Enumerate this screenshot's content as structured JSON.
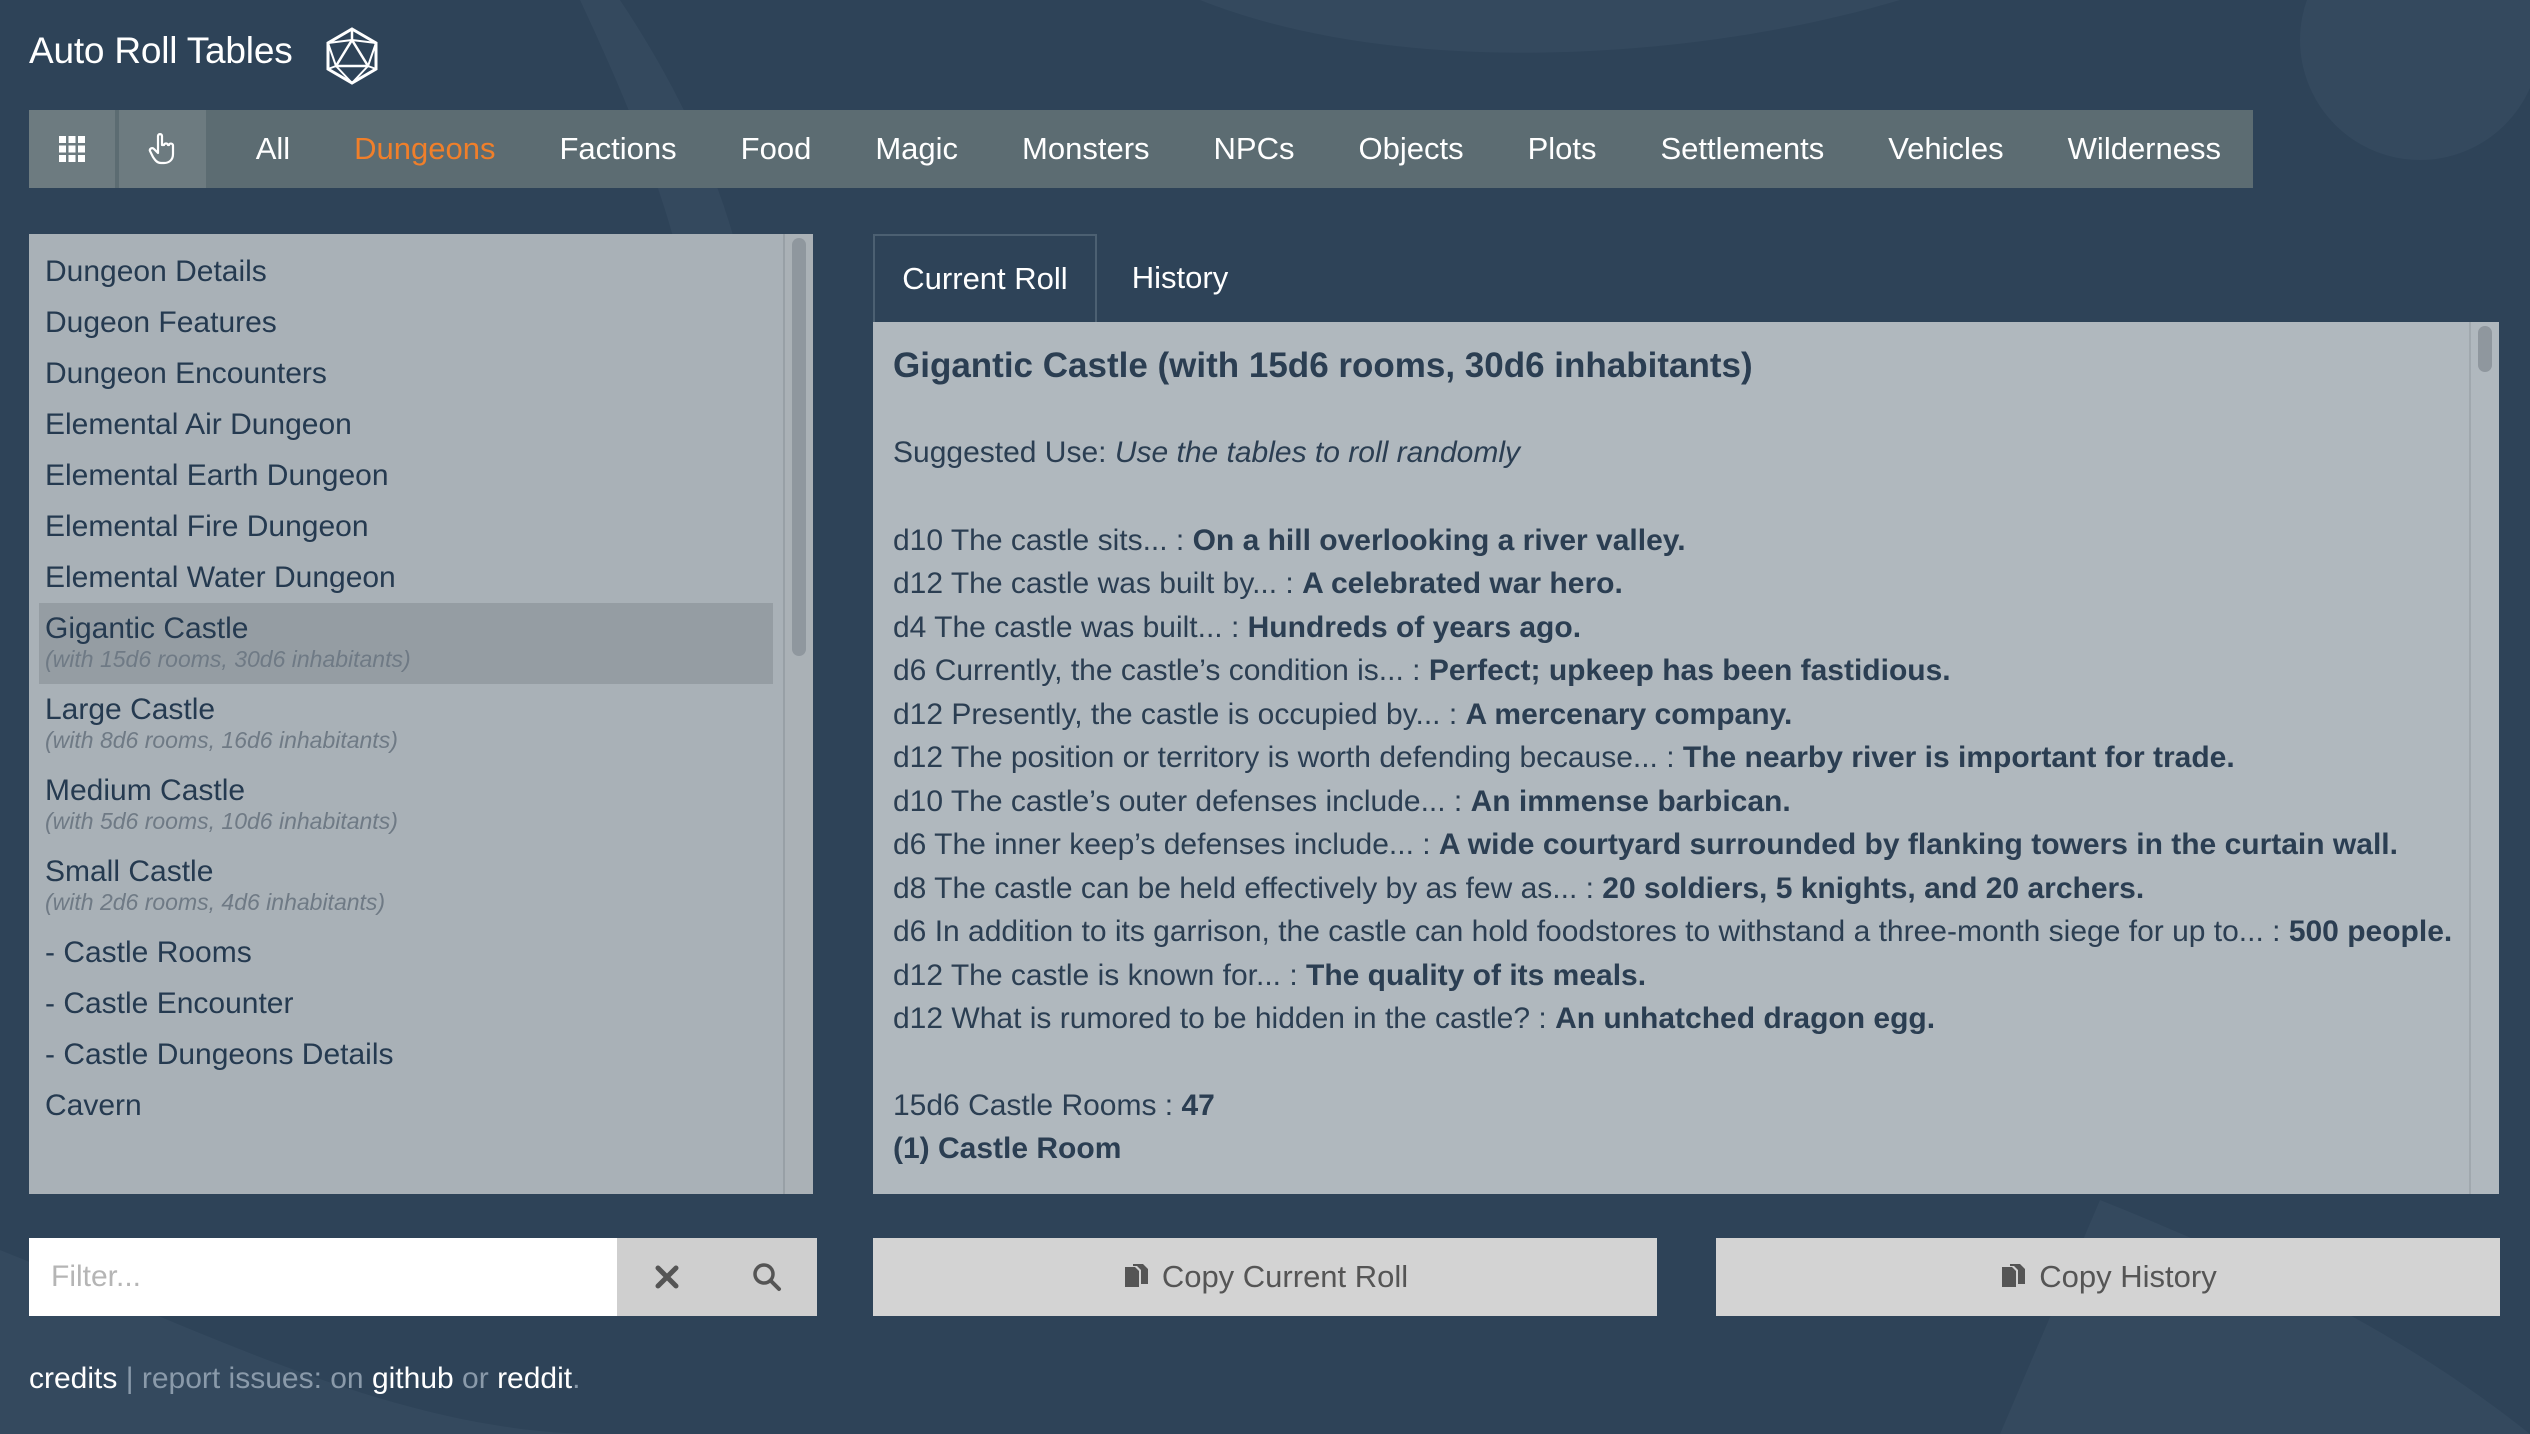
{
  "app": {
    "title": "Auto Roll Tables",
    "logo_icon": "d20-icon"
  },
  "nav": {
    "grid_icon": "grid-icon",
    "hand_icon": "pointer-hand-icon",
    "items": [
      "All",
      "Dungeons",
      "Factions",
      "Food",
      "Magic",
      "Monsters",
      "NPCs",
      "Objects",
      "Plots",
      "Settlements",
      "Vehicles",
      "Wilderness"
    ],
    "active": "Dungeons",
    "active_color": "#f07f2a"
  },
  "list": {
    "items": [
      {
        "label": "Dungeon Details"
      },
      {
        "label": "Dugeon Features"
      },
      {
        "label": "Dungeon Encounters"
      },
      {
        "label": "Elemental Air Dungeon"
      },
      {
        "label": "Elemental Earth Dungeon"
      },
      {
        "label": "Elemental Fire Dungeon"
      },
      {
        "label": "Elemental Water Dungeon"
      },
      {
        "label": "Gigantic Castle",
        "sub": "(with 15d6 rooms, 30d6 inhabitants)",
        "selected": true
      },
      {
        "label": "Large Castle",
        "sub": "(with 8d6 rooms, 16d6 inhabitants)"
      },
      {
        "label": "Medium Castle",
        "sub": "(with 5d6 rooms, 10d6 inhabitants)"
      },
      {
        "label": "Small Castle",
        "sub": "(with 2d6 rooms, 4d6 inhabitants)"
      },
      {
        "label": "- Castle Rooms"
      },
      {
        "label": "- Castle Encounter"
      },
      {
        "label": "- Castle Dungeons Details"
      },
      {
        "label": "Cavern"
      }
    ]
  },
  "filter": {
    "placeholder": "Filter...",
    "clear_icon": "close-icon",
    "search_icon": "search-icon"
  },
  "tabs": {
    "current": "Current Roll",
    "history": "History"
  },
  "roll": {
    "title": "Gigantic Castle (with 15d6 rooms, 30d6 inhabitants)",
    "suggested_label": "Suggested Use: ",
    "suggested_value": "Use the tables to roll randomly",
    "rows": [
      {
        "q": "d10 The castle sits... : ",
        "a": "On a hill overlooking a river valley."
      },
      {
        "q": "d12 The castle was built by... : ",
        "a": "A celebrated war hero."
      },
      {
        "q": "d4 The castle was built... : ",
        "a": "Hundreds of years ago."
      },
      {
        "q": "d6 Currently, the castle’s condition is... : ",
        "a": "Perfect; upkeep has been fastidious."
      },
      {
        "q": "d12 Presently, the castle is occupied by... : ",
        "a": "A mercenary company."
      },
      {
        "q": "d12 The position or territory is worth defending because... : ",
        "a": "The nearby river is important for trade."
      },
      {
        "q": "d10 The castle’s outer defenses include... : ",
        "a": "An immense barbican."
      },
      {
        "q": "d6 The inner keep’s defenses include... : ",
        "a": "A wide courtyard surrounded by flanking towers in the curtain wall."
      },
      {
        "q": "d8 The castle can be held effectively by as few as... : ",
        "a": "20 soldiers, 5 knights, and 20 archers."
      },
      {
        "q": "d6 In addition to its garrison, the castle can hold foodstores to withstand a three-month siege for up to... : ",
        "a": "500 people."
      },
      {
        "q": "d12 The castle is known for... : ",
        "a": "The quality of its meals."
      },
      {
        "q": "d12 What is rumored to be hidden in the castle? : ",
        "a": "An unhatched dragon egg."
      }
    ],
    "rooms_label": "15d6 Castle Rooms : ",
    "rooms_value": "47",
    "room_heading": "(1) Castle Room"
  },
  "buttons": {
    "copy_current": "Copy Current Roll",
    "copy_history": "Copy History",
    "copy_icon": "copy-files-icon"
  },
  "footer": {
    "credits": "credits",
    "sep": " | ",
    "report": "report issues: on ",
    "github": "github",
    "or": " or ",
    "reddit": "reddit",
    "end": "."
  }
}
